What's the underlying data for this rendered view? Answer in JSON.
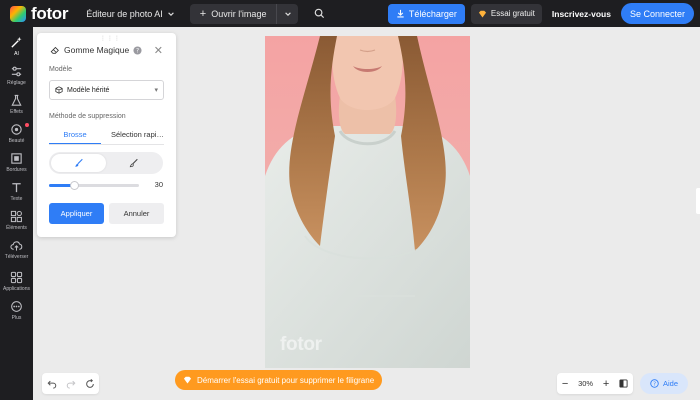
{
  "topbar": {
    "logo_text": "fotor",
    "editor_menu": "Éditeur de photo AI",
    "open_image": "Ouvrir l'image",
    "download": "Télécharger",
    "free_trial": "Essai gratuit",
    "signup": "Inscrivez-vous",
    "login": "Se Connecter"
  },
  "rail": {
    "items": [
      {
        "label": "AI",
        "icon": "magic-wand-icon"
      },
      {
        "label": "Réglage",
        "icon": "sliders-icon"
      },
      {
        "label": "Effets",
        "icon": "flask-icon"
      },
      {
        "label": "Beauté",
        "icon": "eye-icon"
      },
      {
        "label": "Bordures",
        "icon": "frame-icon"
      },
      {
        "label": "Texte",
        "icon": "text-icon"
      },
      {
        "label": "Éléments",
        "icon": "shapes-icon"
      },
      {
        "label": "Téléverser",
        "icon": "cloud-upload-icon"
      },
      {
        "label": "Applications",
        "icon": "grid-icon"
      },
      {
        "label": "Plus",
        "icon": "more-icon"
      }
    ]
  },
  "panel": {
    "title": "Gomme Magique",
    "model_label": "Modèle",
    "model_value": "Modèle hérité",
    "method_label": "Méthode de suppression",
    "tab_brush": "Brosse",
    "tab_quick": "Sélection rapi…",
    "brush_size": "30",
    "brush_size_fraction": 0.28,
    "apply": "Appliquer",
    "cancel": "Annuler"
  },
  "canvas": {
    "watermark": "fotor",
    "background_color": "#f2aba9"
  },
  "bottom": {
    "promo": "Démarrer l'essai gratuit pour supprimer le filigrane",
    "zoom": "30%",
    "help": "Aide"
  },
  "colors": {
    "accent": "#2f7df6",
    "promo": "#ff9a1f",
    "dark": "#1e1e21"
  }
}
